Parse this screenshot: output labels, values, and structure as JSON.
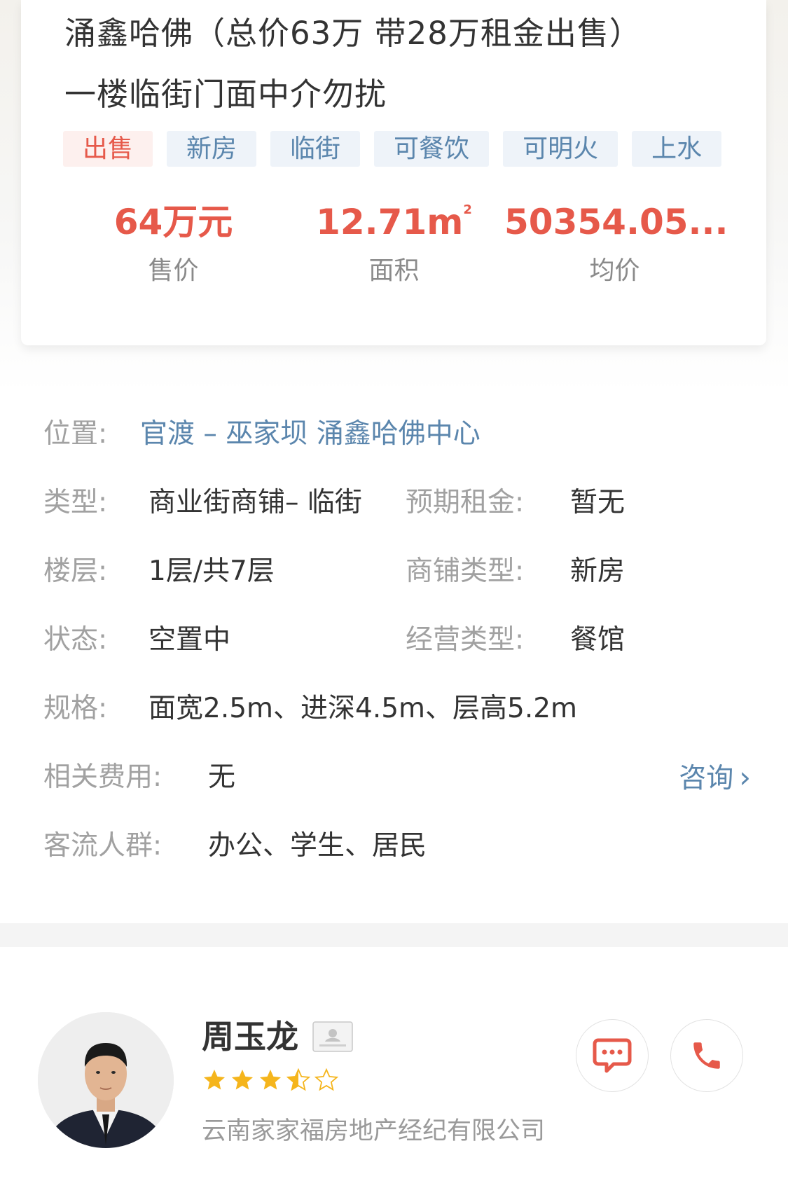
{
  "listing": {
    "title_line1": "涌鑫哈佛（总价63万 带28万租金出售）",
    "title_line2": "一楼临街门面中介勿扰",
    "tags": [
      "出售",
      "新房",
      "临街",
      "可餐饮",
      "可明火",
      "上水"
    ],
    "price_value": "64万元",
    "price_label": "售价",
    "area_value": "12.71m",
    "area_sup": "2",
    "area_label": "面积",
    "unit_price_value": "50354.05...",
    "unit_price_label": "均价"
  },
  "details": {
    "location_label": "位置:",
    "location_value": "官渡 – 巫家坝 涌鑫哈佛中心",
    "type_label": "类型:",
    "type_value": "商业街商铺– 临街",
    "expected_rent_label": "预期租金:",
    "expected_rent_value": "暂无",
    "floor_label": "楼层:",
    "floor_value": "1层/共7层",
    "shop_type_label": "商铺类型:",
    "shop_type_value": "新房",
    "status_label": "状态:",
    "status_value": "空置中",
    "business_type_label": "经营类型:",
    "business_type_value": "餐馆",
    "spec_label": "规格:",
    "spec_value": "面宽2.5m、进深4.5m、层高5.2m",
    "fees_label": "相关费用:",
    "fees_value": "无",
    "consult_label": "咨询",
    "traffic_label": "客流人群:",
    "traffic_value": "办公、学生、居民"
  },
  "agent": {
    "name": "周玉龙",
    "rating": 3.5,
    "rating_max": 5,
    "company": "云南家家福房地产经纪有限公司"
  },
  "colors": {
    "accent_red": "#e6594a",
    "link_blue": "#5b86ad",
    "star_gold": "#f5b51c"
  }
}
